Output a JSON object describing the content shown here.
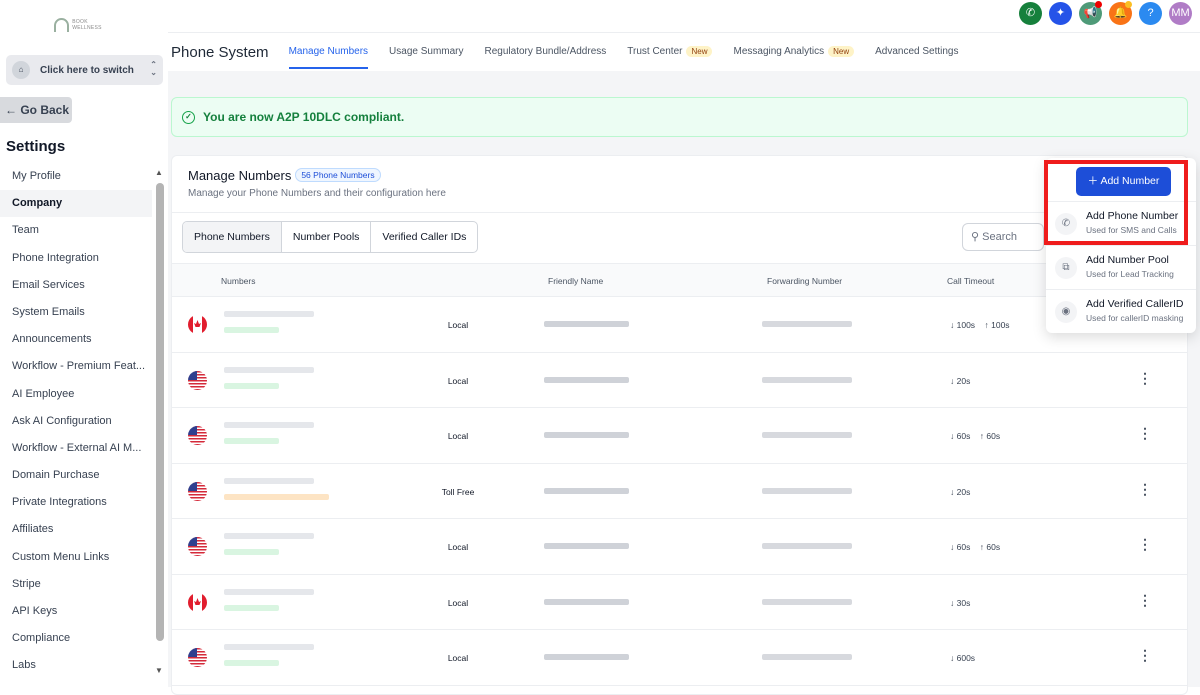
{
  "sidebar": {
    "logo_text": "BOOK WELLNESS",
    "switch_label": "Click here to switch",
    "back_label": "← Go Back",
    "settings_title": "Settings",
    "items": [
      "My Profile",
      "Company",
      "Team",
      "Phone Integration",
      "Email Services",
      "System Emails",
      "Announcements",
      "Workflow - Premium Feat...",
      "AI Employee",
      "Ask AI Configuration",
      "Workflow - External AI M...",
      "Domain Purchase",
      "Private Integrations",
      "Affiliates",
      "Custom Menu Links",
      "Stripe",
      "API Keys",
      "Compliance",
      "Labs"
    ],
    "active": "Company"
  },
  "topbar": {
    "avatar": "MM",
    "help": "?"
  },
  "header": {
    "title": "Phone System",
    "tabs": [
      {
        "label": "Manage Numbers",
        "active": true
      },
      {
        "label": "Usage Summary"
      },
      {
        "label": "Regulatory Bundle/Address"
      },
      {
        "label": "Trust Center",
        "badge": "New"
      },
      {
        "label": "Messaging Analytics",
        "badge": "New"
      },
      {
        "label": "Advanced Settings"
      }
    ]
  },
  "banner": "You are now A2P 10DLC compliant.",
  "card": {
    "title": "Manage Numbers",
    "count_badge": "56 Phone Numbers",
    "subtitle": "Manage your Phone Numbers and their configuration here",
    "segments": [
      "Phone Numbers",
      "Number Pools",
      "Verified Caller IDs"
    ],
    "search_placeholder": "Search",
    "columns": [
      "Numbers",
      "Friendly Name",
      "Forwarding Number",
      "Call Timeout"
    ],
    "rows": [
      {
        "country": "CA",
        "type": "Local",
        "in": "↓ 100s",
        "out": "↑ 100s"
      },
      {
        "country": "US",
        "type": "Local",
        "in": "↓ 20s",
        "out": ""
      },
      {
        "country": "US",
        "type": "Local",
        "in": "↓ 60s",
        "out": "↑ 60s"
      },
      {
        "country": "US",
        "type": "Toll Free",
        "in": "↓ 20s",
        "out": ""
      },
      {
        "country": "US",
        "type": "Local",
        "in": "↓ 60s",
        "out": "↑ 60s"
      },
      {
        "country": "CA",
        "type": "Local",
        "in": "↓ 30s",
        "out": ""
      },
      {
        "country": "US",
        "type": "Local",
        "in": "↓ 600s",
        "out": ""
      }
    ]
  },
  "add_menu": {
    "button": "Add Number",
    "items": [
      {
        "label": "Add Phone Number",
        "sub": "Used for SMS and Calls"
      },
      {
        "label": "Add Number Pool",
        "sub": "Used for Lead Tracking"
      },
      {
        "label": "Add Verified CallerID",
        "sub": "Used for callerID masking"
      }
    ]
  }
}
